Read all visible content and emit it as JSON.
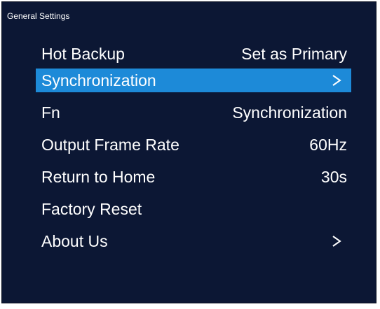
{
  "screen": {
    "title": "General Settings"
  },
  "menu": {
    "items": [
      {
        "label": "Hot Backup",
        "value": "Set as Primary",
        "icon": null,
        "selected": false
      },
      {
        "label": "Synchronization",
        "value": null,
        "icon": "chevron-right-icon",
        "selected": true
      },
      {
        "label": "Fn",
        "value": "Synchronization",
        "icon": null,
        "selected": false
      },
      {
        "label": "Output Frame Rate",
        "value": "60Hz",
        "icon": null,
        "selected": false
      },
      {
        "label": "Return to Home",
        "value": "30s",
        "icon": null,
        "selected": false
      },
      {
        "label": "Factory Reset",
        "value": null,
        "icon": null,
        "selected": false
      },
      {
        "label": "About Us",
        "value": null,
        "icon": "chevron-right-icon",
        "selected": false
      }
    ]
  },
  "colors": {
    "background": "#0c1734",
    "selection": "#1d8ad8",
    "text": "#ffffff"
  }
}
